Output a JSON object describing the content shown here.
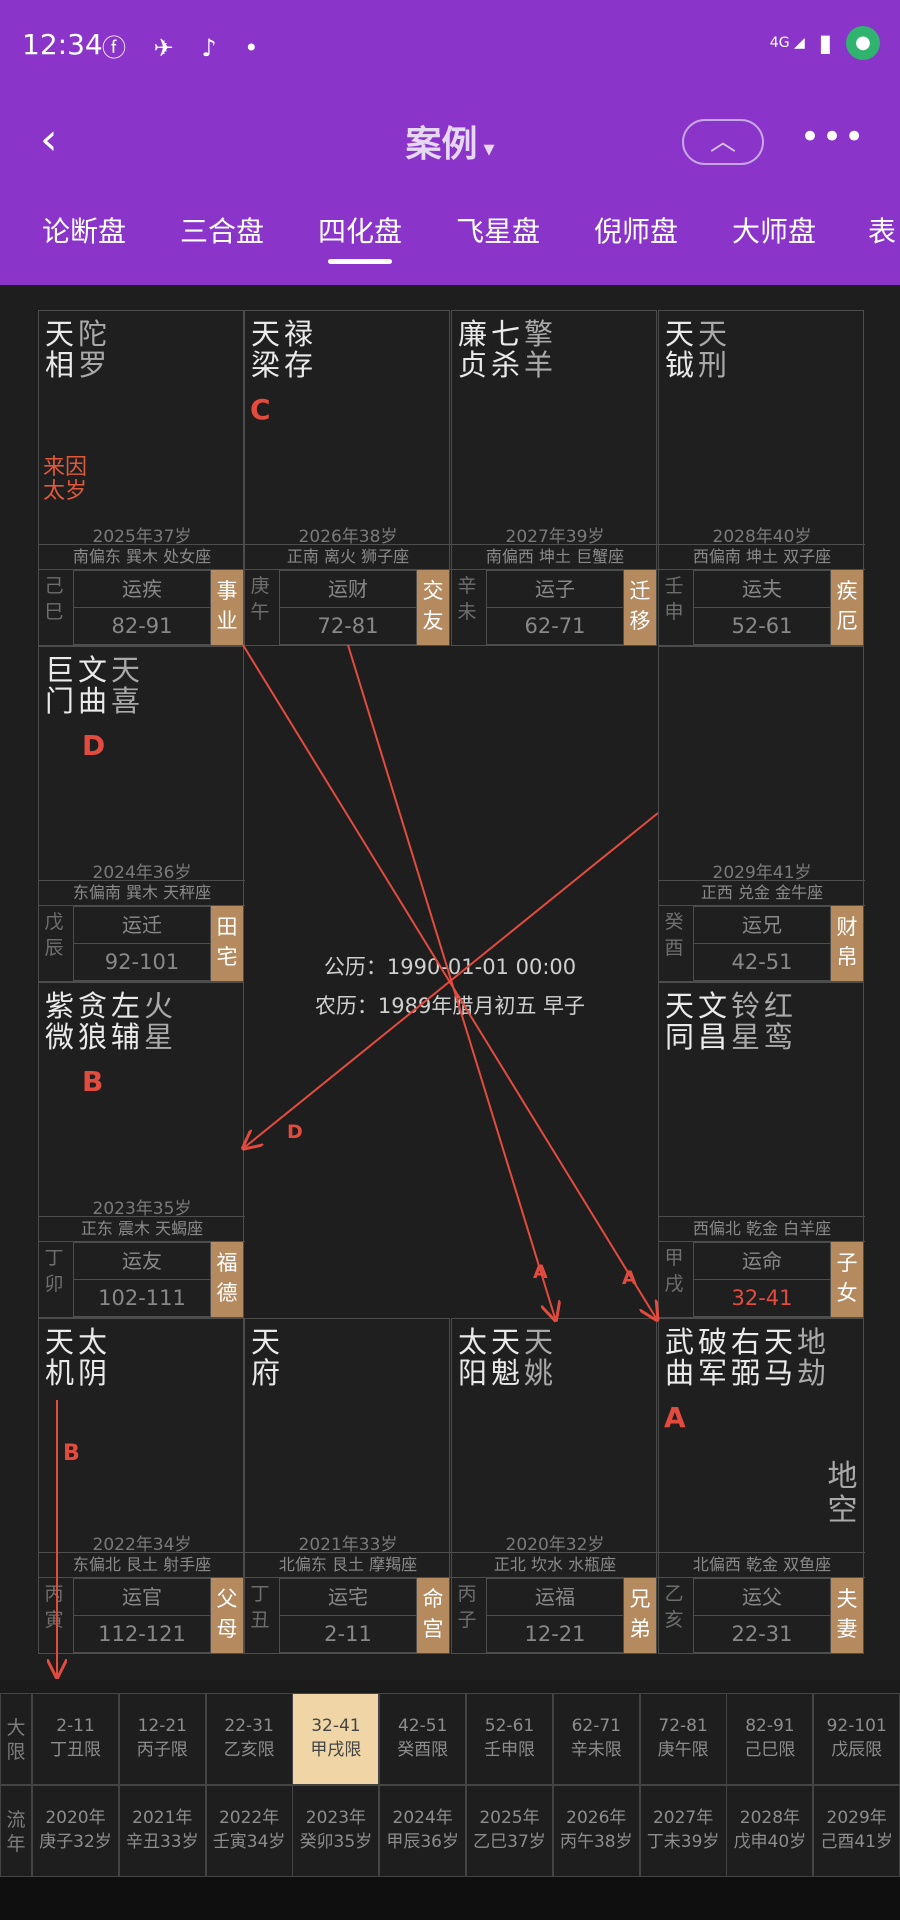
{
  "status": {
    "time": "12:34",
    "app_icons": "ⓕ ✈ ♪ •",
    "signal": "4G"
  },
  "nav": {
    "back": "‹",
    "title": "案例",
    "caret": "▾",
    "up": "︿",
    "more": "•••"
  },
  "tabs": [
    "论断盘",
    "三合盘",
    "四化盘",
    "飞星盘",
    "倪师盘",
    "大师盘",
    "表"
  ],
  "cells": [
    {
      "stars": [
        "天相",
        "陀罗"
      ],
      "minor": [
        1
      ],
      "hua": "",
      "note": "来因太岁",
      "age": "2025年37岁",
      "dir": "南偏东 巽木 处女座",
      "gz": "己巳",
      "yun": "运疾",
      "range": "82-91",
      "gong": "事业"
    },
    {
      "stars": [
        "天梁",
        "禄存"
      ],
      "minor": [],
      "hua": "C",
      "note": "",
      "age": "2026年38岁",
      "dir": "正南 离火 狮子座",
      "gz": "庚午",
      "yun": "运财",
      "range": "72-81",
      "gong": "交友"
    },
    {
      "stars": [
        "廉贞",
        "七杀",
        "擎羊"
      ],
      "minor": [
        2
      ],
      "hua": "",
      "note": "",
      "age": "2027年39岁",
      "dir": "南偏西 坤土 巨蟹座",
      "gz": "辛未",
      "yun": "运子",
      "range": "62-71",
      "gong": "迁移"
    },
    {
      "stars": [
        "天钺",
        "天刑"
      ],
      "minor": [
        1
      ],
      "hua": "",
      "note": "",
      "age": "2028年40岁",
      "dir": "西偏南 坤土 双子座",
      "gz": "壬申",
      "yun": "运夫",
      "range": "52-61",
      "gong": "疾厄"
    },
    {
      "stars": [
        "巨门",
        "文曲",
        "天喜"
      ],
      "minor": [
        2
      ],
      "hua": "D",
      "note": "",
      "age": "2024年36岁",
      "dir": "东偏南 巽木 天秤座",
      "gz": "戊辰",
      "yun": "运迁",
      "range": "92-101",
      "gong": "田宅"
    },
    {
      "stars": [],
      "minor": [],
      "hua": "",
      "note": "",
      "age": "2029年41岁",
      "dir": "正西 兑金 金牛座",
      "gz": "癸酉",
      "yun": "运兄",
      "range": "42-51",
      "gong": "财帛"
    },
    {
      "stars": [
        "紫微",
        "贪狼",
        "左辅",
        "火星"
      ],
      "minor": [
        3
      ],
      "hua": "B",
      "note": "",
      "age": "2023年35岁",
      "dir": "正东 震木 天蝎座",
      "gz": "丁卯",
      "yun": "运友",
      "range": "102-111",
      "gong": "福德"
    },
    {
      "stars": [
        "天同",
        "文昌",
        "铃星",
        "红鸾"
      ],
      "minor": [
        2,
        3
      ],
      "hua": "",
      "note": "",
      "age": "",
      "dir": "西偏北 乾金 白羊座",
      "gz": "甲戌",
      "yun": "运命",
      "range": "32-41",
      "gong": "子女"
    },
    {
      "stars": [
        "天机",
        "太阴"
      ],
      "minor": [],
      "hua": "",
      "note": "",
      "age": "2022年34岁",
      "dir": "东偏北 艮土 射手座",
      "gz": "丙寅",
      "yun": "运官",
      "range": "112-121",
      "gong": "父母"
    },
    {
      "stars": [
        "天府"
      ],
      "minor": [],
      "hua": "",
      "note": "",
      "age": "2021年33岁",
      "dir": "北偏东 艮土 摩羯座",
      "gz": "丁丑",
      "yun": "运宅",
      "range": "2-11",
      "gong": "命宫"
    },
    {
      "stars": [
        "太阳",
        "天魁",
        "天姚"
      ],
      "minor": [
        2
      ],
      "hua": "",
      "note": "",
      "age": "2020年32岁",
      "dir": "正北 坎水 水瓶座",
      "gz": "丙子",
      "yun": "运福",
      "range": "12-21",
      "gong": "兄弟"
    },
    {
      "stars": [
        "武曲",
        "破军",
        "右弼",
        "天马",
        "地劫"
      ],
      "minor": [
        4
      ],
      "hua": "A",
      "note": "",
      "age": "",
      "dir": "北偏西 乾金 双鱼座",
      "gz": "乙亥",
      "yun": "运父",
      "range": "22-31",
      "gong": "夫妻"
    }
  ],
  "extra_star": "地空",
  "center": {
    "solar": "公历：1990-01-01 00:00",
    "lunar": "农历：1989年腊月初五 早子"
  },
  "arrow_labels": {
    "d": "D",
    "a1": "A",
    "a2": "A",
    "b": "B"
  },
  "bottom": {
    "da_label": "大限",
    "da": [
      [
        "2-11",
        "丁丑限"
      ],
      [
        "12-21",
        "丙子限"
      ],
      [
        "22-31",
        "乙亥限"
      ],
      [
        "32-41",
        "甲戌限"
      ],
      [
        "42-51",
        "癸酉限"
      ],
      [
        "52-61",
        "壬申限"
      ],
      [
        "62-71",
        "辛未限"
      ],
      [
        "72-81",
        "庚午限"
      ],
      [
        "82-91",
        "己巳限"
      ],
      [
        "92-101",
        "戊辰限"
      ]
    ],
    "liu_label": "流年",
    "liu": [
      [
        "2020年",
        "庚子32岁"
      ],
      [
        "2021年",
        "辛丑33岁"
      ],
      [
        "2022年",
        "壬寅34岁"
      ],
      [
        "2023年",
        "癸卯35岁"
      ],
      [
        "2024年",
        "甲辰36岁"
      ],
      [
        "2025年",
        "乙巳37岁"
      ],
      [
        "2026年",
        "丙午38岁"
      ],
      [
        "2027年",
        "丁未39岁"
      ],
      [
        "2028年",
        "戊申40岁"
      ],
      [
        "2029年",
        "己酉41岁"
      ]
    ]
  },
  "colors": {
    "purple": "#8a34c9",
    "hua": "#e34b3f",
    "gong": "#b48a5e",
    "selected": "#f0d6a6"
  }
}
